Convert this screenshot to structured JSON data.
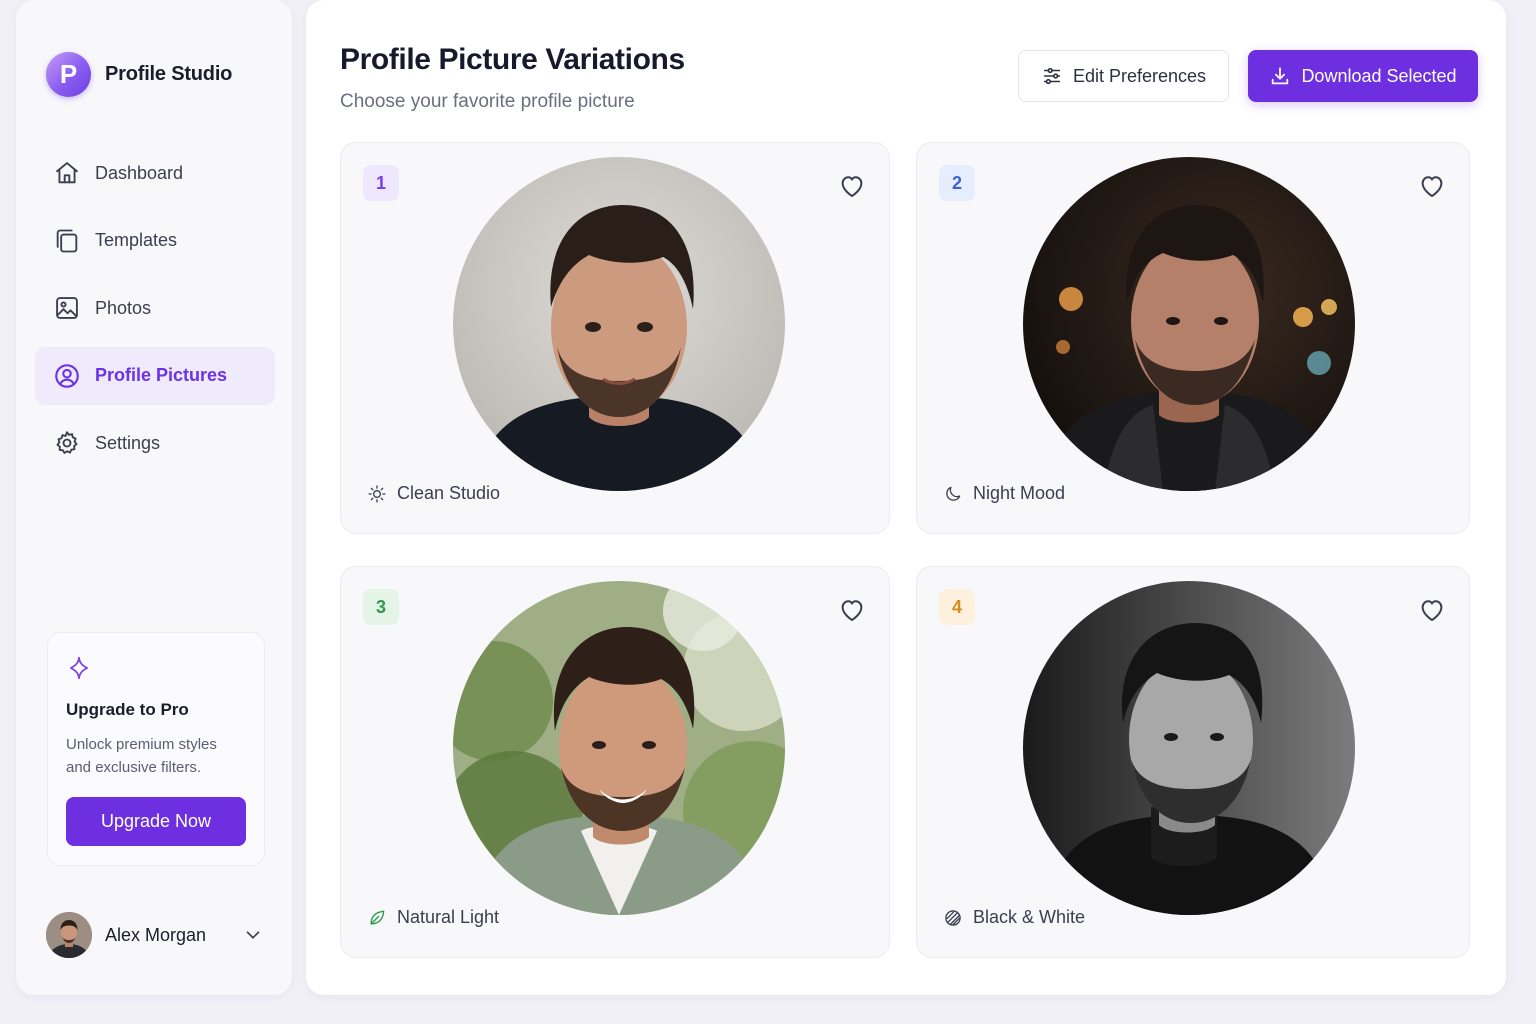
{
  "app": {
    "brand_letter": "P",
    "brand_name": "Profile Studio",
    "accent_color": "#6d2fe0"
  },
  "sidebar": {
    "items": [
      {
        "label": "Dashboard",
        "icon": "home-icon",
        "active": false
      },
      {
        "label": "Templates",
        "icon": "templates-icon",
        "active": false
      },
      {
        "label": "Photos",
        "icon": "image-icon",
        "active": false
      },
      {
        "label": "Profile Pictures",
        "icon": "user-circle-icon",
        "active": true
      },
      {
        "label": "Settings",
        "icon": "gear-icon",
        "active": false
      }
    ],
    "upgrade": {
      "title": "Upgrade to Pro",
      "description": "Unlock premium styles and exclusive filters.",
      "button": "Upgrade Now"
    },
    "user": {
      "name": "Alex Morgan"
    }
  },
  "header": {
    "title": "Profile Picture Variations",
    "subtitle": "Choose your favorite profile picture",
    "edit_button": "Edit Preferences",
    "download_button": "Download Selected"
  },
  "variations": [
    {
      "number": "1",
      "label": "Clean Studio",
      "icon": "sun-icon",
      "badge_bg": "#efe7fd",
      "badge_fg": "#7b3fe4"
    },
    {
      "number": "2",
      "label": "Night Mood",
      "icon": "moon-icon",
      "badge_bg": "#e6edfc",
      "badge_fg": "#3b63d6"
    },
    {
      "number": "3",
      "label": "Natural Light",
      "icon": "leaf-icon",
      "badge_bg": "#e4f5e8",
      "badge_fg": "#2f9a4e"
    },
    {
      "number": "4",
      "label": "Black & White",
      "icon": "contrast-icon",
      "badge_bg": "#fdf0dc",
      "badge_fg": "#d98a1c"
    }
  ]
}
